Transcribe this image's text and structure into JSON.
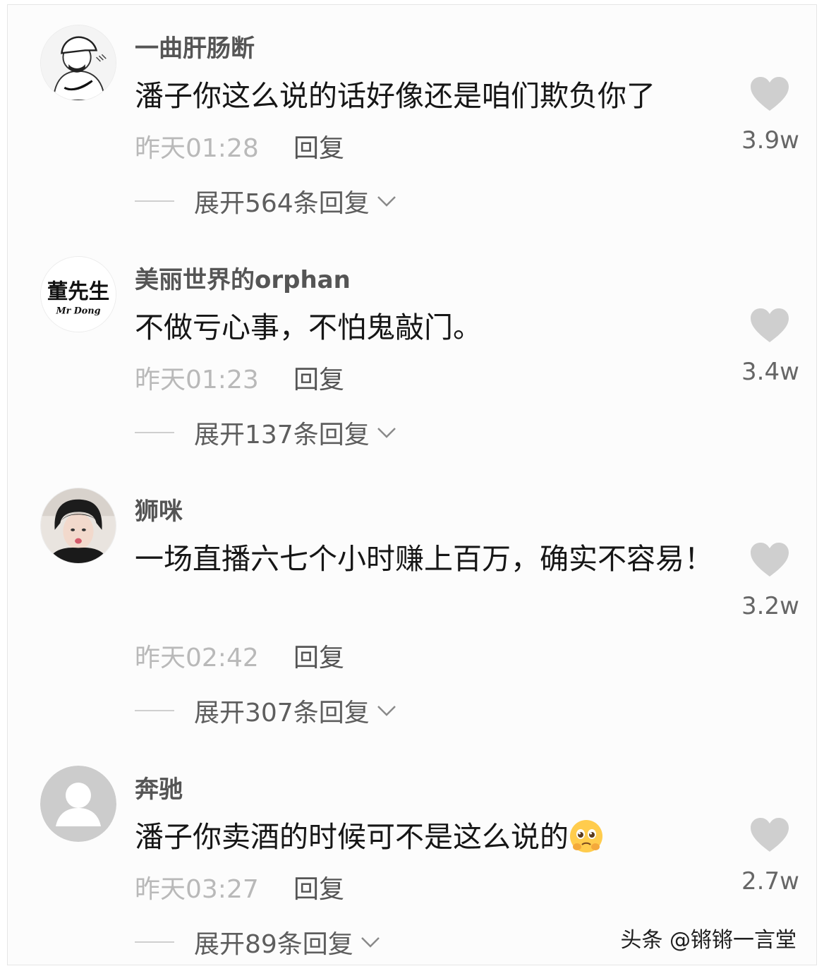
{
  "comments": [
    {
      "username": "一曲肝肠断",
      "text": "潘子你这么说的话好像还是咱们欺负你了",
      "time": "昨天01:28",
      "reply": "回复",
      "expand": "展开564条回复",
      "likes": "3.9w",
      "avatar_icon": "nike-cap-avatar-icon"
    },
    {
      "username": "美丽世界的orphan",
      "text": "不做亏心事，不怕鬼敲门。",
      "time": "昨天01:23",
      "reply": "回复",
      "expand": "展开137条回复",
      "likes": "3.4w",
      "avatar_icon": "calligraphy-avatar-icon",
      "avatar_text": "董先生",
      "avatar_subtext": "Mr Dong"
    },
    {
      "username": "狮咪",
      "text": "一场直播六七个小时赚上百万，确实不容易！",
      "time": "昨天02:42",
      "reply": "回复",
      "expand": "展开307条回复",
      "likes": "3.2w",
      "avatar_icon": "photo-avatar-icon"
    },
    {
      "username": "奔驰",
      "text": "潘子你卖酒的时候可不是这么说的",
      "time": "昨天03:27",
      "reply": "回复",
      "expand": "展开89条回复",
      "likes": "2.7w",
      "avatar_icon": "default-avatar-icon",
      "emoji_icon": "pleading-face-emoji-icon"
    }
  ],
  "watermark": "头条 @锵锵一言堂",
  "colors": {
    "username": "#555555",
    "text": "#161616",
    "meta": "#b9b9b9",
    "heart": "#cfcfcf"
  }
}
